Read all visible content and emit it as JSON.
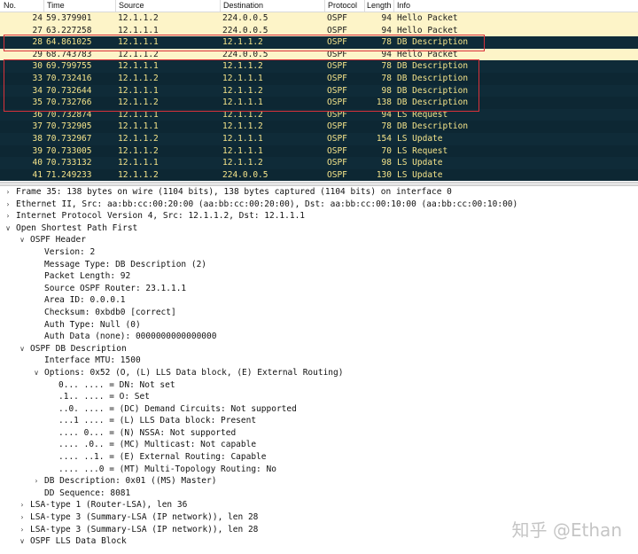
{
  "columns": {
    "no": "No.",
    "time": "Time",
    "source": "Source",
    "destination": "Destination",
    "protocol": "Protocol",
    "length": "Length",
    "info": "Info"
  },
  "packets": [
    {
      "no": "24",
      "time": "59.379901",
      "source": "12.1.1.2",
      "destination": "224.0.0.5",
      "protocol": "OSPF",
      "length": "94",
      "info": "Hello Packet",
      "style": "light"
    },
    {
      "no": "27",
      "time": "63.227258",
      "source": "12.1.1.1",
      "destination": "224.0.0.5",
      "protocol": "OSPF",
      "length": "94",
      "info": "Hello Packet",
      "style": "light"
    },
    {
      "no": "28",
      "time": "64.861025",
      "source": "12.1.1.1",
      "destination": "12.1.1.2",
      "protocol": "OSPF",
      "length": "78",
      "info": "DB Description",
      "style": "dark"
    },
    {
      "no": "29",
      "time": "68.743783",
      "source": "12.1.1.2",
      "destination": "224.0.0.5",
      "protocol": "OSPF",
      "length": "94",
      "info": "Hello Packet",
      "style": "light"
    },
    {
      "no": "30",
      "time": "69.799755",
      "source": "12.1.1.1",
      "destination": "12.1.1.2",
      "protocol": "OSPF",
      "length": "78",
      "info": "DB Description",
      "style": "dark"
    },
    {
      "no": "33",
      "time": "70.732416",
      "source": "12.1.1.2",
      "destination": "12.1.1.1",
      "protocol": "OSPF",
      "length": "78",
      "info": "DB Description",
      "style": "dark"
    },
    {
      "no": "34",
      "time": "70.732644",
      "source": "12.1.1.1",
      "destination": "12.1.1.2",
      "protocol": "OSPF",
      "length": "98",
      "info": "DB Description",
      "style": "dark"
    },
    {
      "no": "35",
      "time": "70.732766",
      "source": "12.1.1.2",
      "destination": "12.1.1.1",
      "protocol": "OSPF",
      "length": "138",
      "info": "DB Description",
      "style": "dark"
    },
    {
      "no": "36",
      "time": "70.732874",
      "source": "12.1.1.1",
      "destination": "12.1.1.2",
      "protocol": "OSPF",
      "length": "94",
      "info": "LS Request",
      "style": "dark"
    },
    {
      "no": "37",
      "time": "70.732905",
      "source": "12.1.1.1",
      "destination": "12.1.1.2",
      "protocol": "OSPF",
      "length": "78",
      "info": "DB Description",
      "style": "dark"
    },
    {
      "no": "38",
      "time": "70.732967",
      "source": "12.1.1.2",
      "destination": "12.1.1.1",
      "protocol": "OSPF",
      "length": "154",
      "info": "LS Update",
      "style": "dark"
    },
    {
      "no": "39",
      "time": "70.733005",
      "source": "12.1.1.2",
      "destination": "12.1.1.1",
      "protocol": "OSPF",
      "length": "70",
      "info": "LS Request",
      "style": "dark"
    },
    {
      "no": "40",
      "time": "70.733132",
      "source": "12.1.1.1",
      "destination": "12.1.1.2",
      "protocol": "OSPF",
      "length": "98",
      "info": "LS Update",
      "style": "dark"
    },
    {
      "no": "41",
      "time": "71.249233",
      "source": "12.1.1.2",
      "destination": "224.0.0.5",
      "protocol": "OSPF",
      "length": "130",
      "info": "LS Update",
      "style": "dark"
    }
  ],
  "details": [
    {
      "level": 0,
      "arrow": "right",
      "text": "Frame 35: 138 bytes on wire (1104 bits), 138 bytes captured (1104 bits) on interface 0"
    },
    {
      "level": 0,
      "arrow": "right",
      "text": "Ethernet II, Src: aa:bb:cc:00:20:00 (aa:bb:cc:00:20:00), Dst: aa:bb:cc:00:10:00 (aa:bb:cc:00:10:00)"
    },
    {
      "level": 0,
      "arrow": "right",
      "text": "Internet Protocol Version 4, Src: 12.1.1.2, Dst: 12.1.1.1"
    },
    {
      "level": 0,
      "arrow": "down",
      "text": "Open Shortest Path First"
    },
    {
      "level": 1,
      "arrow": "down",
      "text": "OSPF Header"
    },
    {
      "level": 2,
      "arrow": "",
      "text": "Version: 2"
    },
    {
      "level": 2,
      "arrow": "",
      "text": "Message Type: DB Description (2)"
    },
    {
      "level": 2,
      "arrow": "",
      "text": "Packet Length: 92"
    },
    {
      "level": 2,
      "arrow": "",
      "text": "Source OSPF Router: 23.1.1.1"
    },
    {
      "level": 2,
      "arrow": "",
      "text": "Area ID: 0.0.0.1"
    },
    {
      "level": 2,
      "arrow": "",
      "text": "Checksum: 0xbdb0 [correct]"
    },
    {
      "level": 2,
      "arrow": "",
      "text": "Auth Type: Null (0)"
    },
    {
      "level": 2,
      "arrow": "",
      "text": "Auth Data (none): 0000000000000000"
    },
    {
      "level": 1,
      "arrow": "down",
      "text": "OSPF DB Description"
    },
    {
      "level": 2,
      "arrow": "",
      "text": "Interface MTU: 1500"
    },
    {
      "level": 2,
      "arrow": "down",
      "text": "Options: 0x52 (O, (L) LLS Data block, (E) External Routing)"
    },
    {
      "level": 3,
      "arrow": "",
      "text": "0... .... = DN: Not set"
    },
    {
      "level": 3,
      "arrow": "",
      "text": ".1.. .... = O: Set"
    },
    {
      "level": 3,
      "arrow": "",
      "text": "..0. .... = (DC) Demand Circuits: Not supported"
    },
    {
      "level": 3,
      "arrow": "",
      "text": "...1 .... = (L) LLS Data block: Present"
    },
    {
      "level": 3,
      "arrow": "",
      "text": ".... 0... = (N) NSSA: Not supported"
    },
    {
      "level": 3,
      "arrow": "",
      "text": ".... .0.. = (MC) Multicast: Not capable"
    },
    {
      "level": 3,
      "arrow": "",
      "text": ".... ..1. = (E) External Routing: Capable"
    },
    {
      "level": 3,
      "arrow": "",
      "text": ".... ...0 = (MT) Multi-Topology Routing: No"
    },
    {
      "level": 2,
      "arrow": "right",
      "text": "DB Description: 0x01 ((MS) Master)"
    },
    {
      "level": 2,
      "arrow": "",
      "text": "DD Sequence: 8081"
    },
    {
      "level": 1,
      "arrow": "right",
      "text": "LSA-type 1 (Router-LSA), len 36"
    },
    {
      "level": 1,
      "arrow": "right",
      "text": "LSA-type 3 (Summary-LSA (IP network)), len 28"
    },
    {
      "level": 1,
      "arrow": "right",
      "text": "LSA-type 3 (Summary-LSA (IP network)), len 28"
    },
    {
      "level": 1,
      "arrow": "down",
      "text": "OSPF LLS Data Block"
    }
  ],
  "watermark": "知乎 @Ethan",
  "colors": {
    "light_row": "#fdf4c8",
    "dark_row": "#0d2733",
    "dark_text": "#f5e48a",
    "highlight_box": "#d9323a"
  }
}
